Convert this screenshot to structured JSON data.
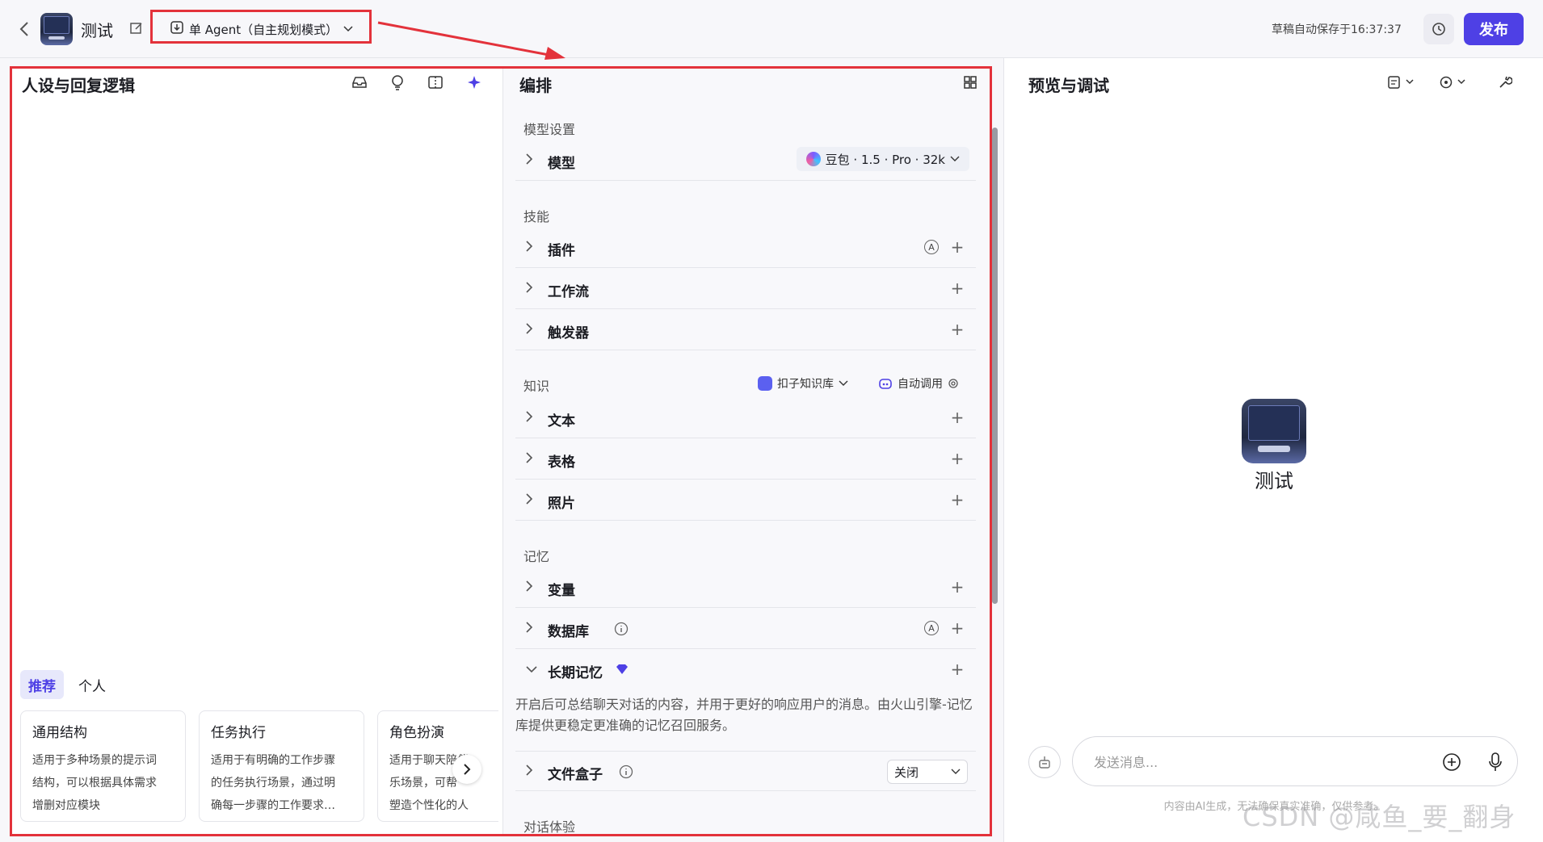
{
  "topbar": {
    "bot_name": "测试",
    "agent_mode": "单 Agent（自主规划模式）",
    "autosave": "草稿自动保存于16:37:37",
    "publish": "发布",
    "accent_color": "#4e40e5",
    "highlight_color": "#e3323b"
  },
  "persona": {
    "title": "人设与回复逻辑",
    "tabs": [
      "推荐",
      "个人"
    ],
    "templates": [
      {
        "title": "通用结构",
        "desc": [
          "适用于多种场景的提示词",
          "结构，可以根据具体需求",
          "增删对应模块"
        ]
      },
      {
        "title": "任务执行",
        "desc": [
          "适用于有明确的工作步骤",
          "的任务执行场景，通过明",
          "确每一步骤的工作要求…"
        ]
      },
      {
        "title": "角色扮演",
        "desc": [
          "适用于聊天陪伴",
          "乐场景，可帮",
          "塑造个性化的人"
        ]
      }
    ]
  },
  "orchestration": {
    "title": "编排",
    "sections": {
      "model": "模型设置",
      "skills": "技能",
      "knowledge": "知识",
      "memory": "记忆",
      "dialog": "对话体验"
    },
    "model_row": {
      "label": "模型",
      "value": "豆包 · 1.5 · Pro · 32k"
    },
    "skill_rows": [
      "插件",
      "工作流",
      "触发器"
    ],
    "knowledge_source": "扣子知识库",
    "knowledge_call": "自动调用",
    "knowledge_rows": [
      "文本",
      "表格",
      "照片"
    ],
    "memory_rows": [
      "变量",
      "数据库",
      "长期记忆"
    ],
    "long_memory_desc": "开启后可总结聊天对话的内容，并用于更好的响应用户的消息。由火山引擎-记忆库提供更稳定更准确的记忆召回服务。",
    "file_box": {
      "label": "文件盒子",
      "value": "关闭"
    }
  },
  "preview": {
    "title": "预览与调试",
    "bot_name": "测试",
    "input_placeholder": "发送消息...",
    "disclaimer": "内容由AI生成，无法确保真实准确，仅供参考。",
    "watermark": "CSDN @咸鱼_要_翻身"
  }
}
